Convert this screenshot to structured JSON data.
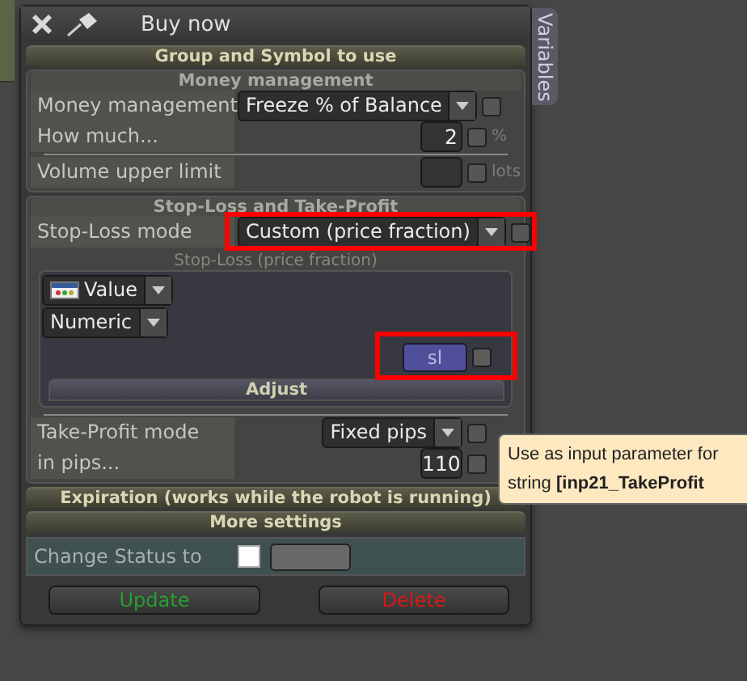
{
  "window": {
    "title": "Buy now"
  },
  "side_tab": {
    "label": "Variables"
  },
  "group_header": "Group and Symbol to use",
  "money_management": {
    "header": "Money management",
    "rows": [
      {
        "kind": "dropdown",
        "label": "Money management",
        "value": "Freeze % of Balance",
        "checked": false
      },
      {
        "kind": "number",
        "label": "How much...",
        "value": "2",
        "checked": false,
        "unit": "%"
      },
      {
        "kind": "divider"
      },
      {
        "kind": "number",
        "label": "Volume upper limit",
        "checked": false,
        "unit": "lots"
      }
    ]
  },
  "stop_loss": {
    "header": "Stop-Loss and Take-Profit",
    "mode": {
      "label": "Stop-Loss mode",
      "value": "Custom (price fraction)",
      "checked": false,
      "highlighted": true
    },
    "caption": "Stop-Loss (price fraction)",
    "panel": {
      "source": "Value",
      "type": "Numeric",
      "variable": "sl",
      "checked": false,
      "highlighted": true,
      "adjust": "Adjust"
    }
  },
  "take_profit": {
    "rows": [
      {
        "kind": "dropdown",
        "label": "Take-Profit mode",
        "value": "Fixed pips",
        "checked": false
      },
      {
        "kind": "number",
        "label": "in pips...",
        "value": "110",
        "checked": false
      }
    ]
  },
  "collapsed_headers": [
    "Expiration (works while the robot is running)",
    "More settings"
  ],
  "status": {
    "label": "Change Status to",
    "checked": false
  },
  "buttons": [
    {
      "label": "Update",
      "kind": "update"
    },
    {
      "label": "Delete",
      "kind": "delete"
    }
  ],
  "tooltip": {
    "lines": [
      "Use as input parameter for",
      "string **[inp21_TakeProfit**"
    ]
  }
}
